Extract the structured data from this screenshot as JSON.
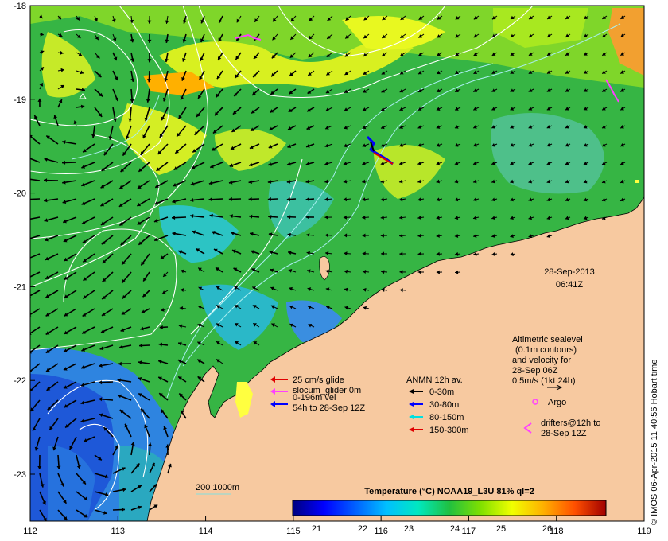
{
  "map": {
    "x_ticks": [
      "112",
      "113",
      "114",
      "115",
      "116",
      "117",
      "118",
      "119"
    ],
    "y_ticks": [
      "-18",
      "-19",
      "-20",
      "-21",
      "-22",
      "-23"
    ],
    "date": "28-Sep-2013",
    "time": "06:41Z",
    "credit": "© IMOS 06-Apr-2015 11:40:56 Hobart time",
    "scale_bar": "200 1000m",
    "colors": {
      "land": "#f7c9a0",
      "ocean_green": "#3fbf3f",
      "ocean_blue": "#3a8fe0",
      "current_arrow": "#000000",
      "contour": "#ffffff",
      "isobath": "#9fe0e8"
    }
  },
  "glider_legend": {
    "line1": "25 cm/s glide",
    "line2": "slocum_glider 0m",
    "line3": "0-196m vel",
    "line4": "54h to 28-Sep 12Z",
    "colors": [
      "#e00000",
      "#ff40ff",
      "#0000ff"
    ]
  },
  "anmn_legend": {
    "title": "ANMN 12h av.",
    "items": [
      {
        "label": "0-30m",
        "color": "#000000"
      },
      {
        "label": "30-80m",
        "color": "#0000ff"
      },
      {
        "label": "80-150m",
        "color": "#00e0e0"
      },
      {
        "label": "150-300m",
        "color": "#e00000"
      }
    ]
  },
  "altimetry_legend": {
    "line1": "Altimetric sealevel",
    "line2": "(0.1m contours)",
    "line3": "and velocity for",
    "line4": "28-Sep 06Z",
    "line5": "0.5m/s (1kt 24h)"
  },
  "argo_label": "Argo",
  "drifters": {
    "line1": "drifters@12h to",
    "line2": "28-Sep 12Z"
  },
  "colorbar": {
    "title": "Temperature (°C) NOAA19_L3U 81% ql=2",
    "ticks": [
      "21",
      "22",
      "23",
      "24",
      "25",
      "26"
    ],
    "colors": [
      "#00007f",
      "#0000ff",
      "#0080ff",
      "#00e0ff",
      "#40ff80",
      "#00c000",
      "#c0ff00",
      "#ffff00",
      "#ffa000",
      "#ff4000",
      "#a00000"
    ]
  }
}
